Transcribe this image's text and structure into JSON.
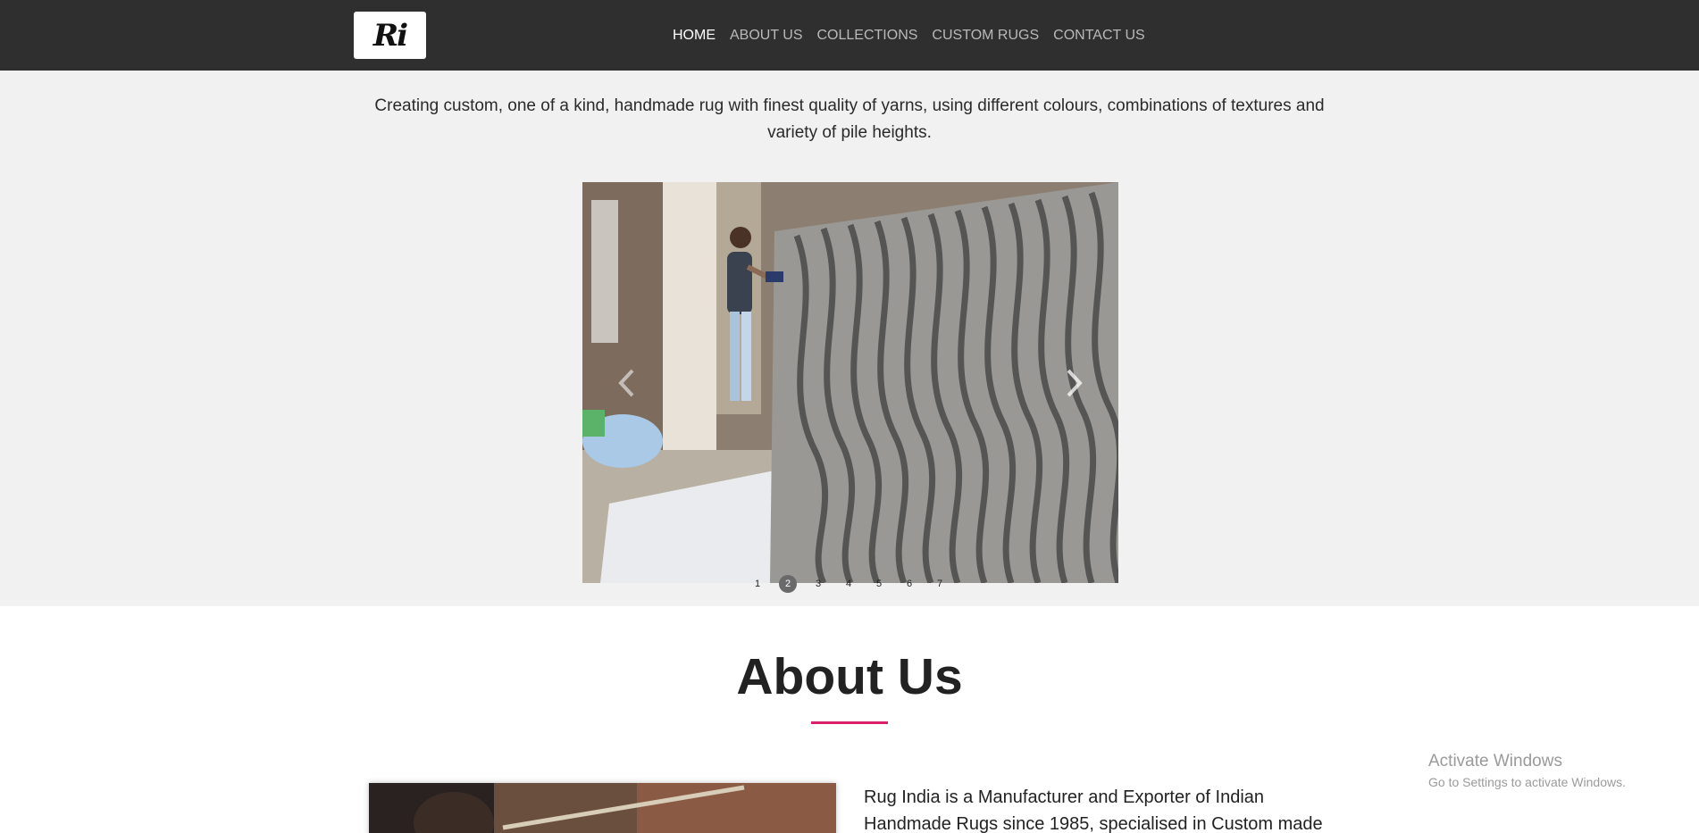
{
  "header": {
    "logo_text": "Ri",
    "nav": [
      {
        "label": "HOME",
        "active": true
      },
      {
        "label": "ABOUT US"
      },
      {
        "label": "COLLECTIONS"
      },
      {
        "label": "CUSTOM RUGS"
      },
      {
        "label": "CONTACT US"
      }
    ]
  },
  "hero": {
    "tagline": "Creating custom, one of a kind, handmade rug with finest quality of yarns, using different colours, combinations of textures and variety of pile heights.",
    "slider": {
      "pages": [
        "1",
        "2",
        "3",
        "4",
        "5",
        "6",
        "7"
      ],
      "active_page": "2"
    }
  },
  "about": {
    "title": "About Us",
    "text": "Rug India is a Manufacturer and Exporter of Indian Handmade Rugs since 1985, specialised in Custom made"
  },
  "watermark": {
    "title": "Activate Windows",
    "subtitle": "Go to Settings to activate Windows."
  },
  "colors": {
    "header_bg": "#2f2f2f",
    "hero_bg": "#f1f1f1",
    "accent": "#d8216a"
  }
}
